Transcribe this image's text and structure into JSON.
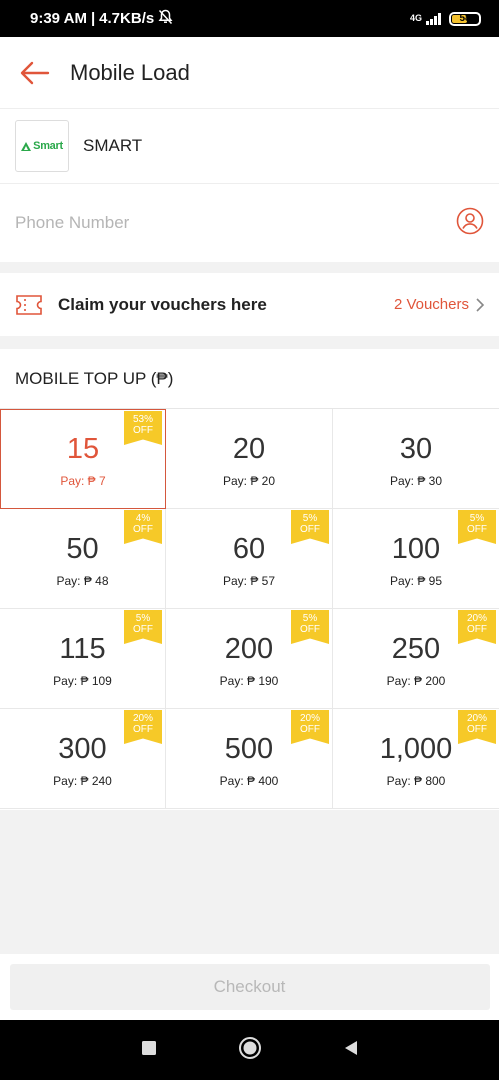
{
  "status_bar": {
    "time": "9:39 AM",
    "separator": "|",
    "speed": "4.7KB/s",
    "network": "4G",
    "battery": "58"
  },
  "header": {
    "title": "Mobile Load"
  },
  "operator": {
    "logo_text": "Smart",
    "name": "SMART"
  },
  "phone": {
    "placeholder": "Phone Number",
    "value": ""
  },
  "voucher": {
    "label": "Claim your vouchers here",
    "count": "2 Vouchers"
  },
  "topup": {
    "title": "MOBILE TOP UP (₱)",
    "off_label": "OFF",
    "items": [
      {
        "amount": "15",
        "pay": "Pay: ₱ 7",
        "discount": "53%",
        "selected": true
      },
      {
        "amount": "20",
        "pay": "Pay: ₱ 20",
        "discount": ""
      },
      {
        "amount": "30",
        "pay": "Pay: ₱ 30",
        "discount": ""
      },
      {
        "amount": "50",
        "pay": "Pay: ₱ 48",
        "discount": "4%"
      },
      {
        "amount": "60",
        "pay": "Pay: ₱ 57",
        "discount": "5%"
      },
      {
        "amount": "100",
        "pay": "Pay: ₱ 95",
        "discount": "5%"
      },
      {
        "amount": "115",
        "pay": "Pay: ₱ 109",
        "discount": "5%"
      },
      {
        "amount": "200",
        "pay": "Pay: ₱ 190",
        "discount": "5%"
      },
      {
        "amount": "250",
        "pay": "Pay: ₱ 200",
        "discount": "20%"
      },
      {
        "amount": "300",
        "pay": "Pay: ₱ 240",
        "discount": "20%"
      },
      {
        "amount": "500",
        "pay": "Pay: ₱ 400",
        "discount": "20%"
      },
      {
        "amount": "1,000",
        "pay": "Pay: ₱ 800",
        "discount": "20%"
      }
    ]
  },
  "checkout": {
    "label": "Checkout"
  },
  "colors": {
    "accent": "#e0553a",
    "badge": "#f6c928",
    "smart_green": "#2aa84a"
  }
}
